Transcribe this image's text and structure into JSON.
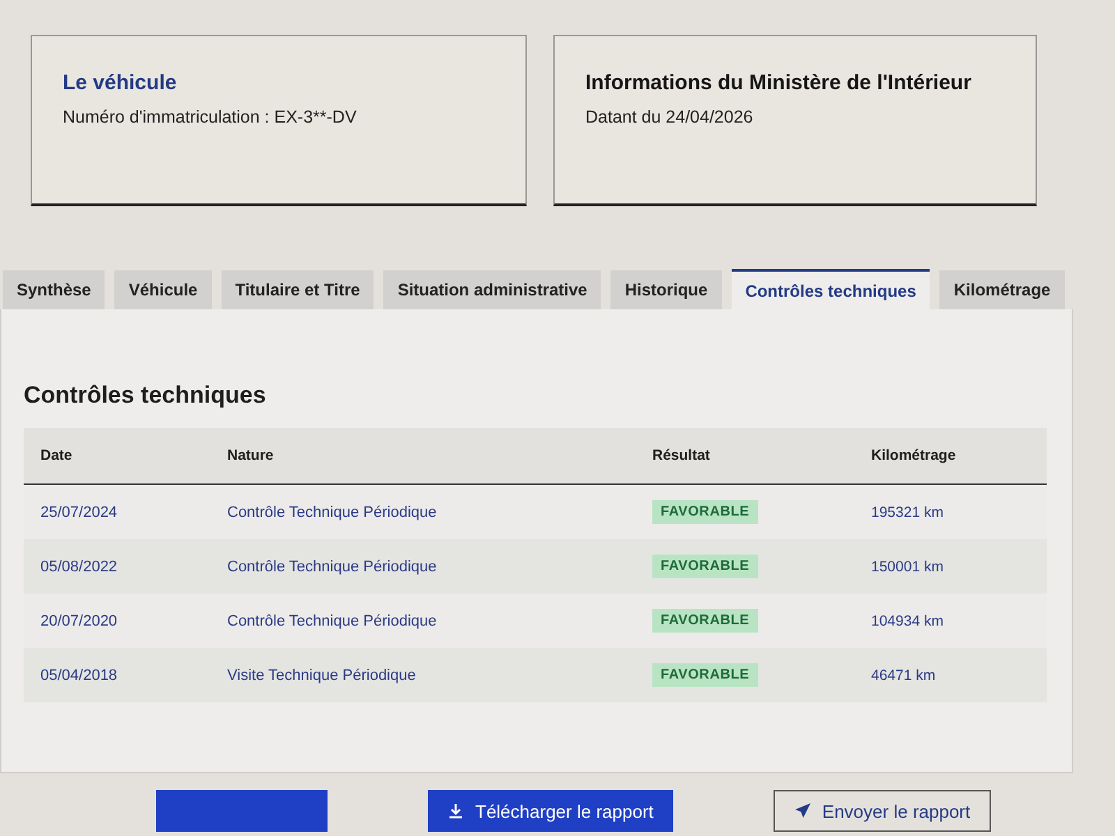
{
  "cards": [
    {
      "title": "Le véhicule",
      "text": "Numéro d'immatriculation : EX-3**-DV"
    },
    {
      "title": "Informations du Ministère de l'Intérieur",
      "text": "Datant du 24/04/2026"
    }
  ],
  "tabs": [
    {
      "label": "Synthèse",
      "selected": false
    },
    {
      "label": "Véhicule",
      "selected": false
    },
    {
      "label": "Titulaire et Titre",
      "selected": false
    },
    {
      "label": "Situation administrative",
      "selected": false
    },
    {
      "label": "Historique",
      "selected": false
    },
    {
      "label": "Contrôles techniques",
      "selected": true
    },
    {
      "label": "Kilométrage",
      "selected": false
    }
  ],
  "section": {
    "title": "Contrôles techniques",
    "columns": [
      "Date",
      "Nature",
      "Résultat",
      "Kilométrage"
    ],
    "rows": [
      {
        "date": "25/07/2024",
        "nature": "Contrôle Technique Périodique",
        "result": "FAVORABLE",
        "mileage": "195321 km"
      },
      {
        "date": "05/08/2022",
        "nature": "Contrôle Technique Périodique",
        "result": "FAVORABLE",
        "mileage": "150001 km"
      },
      {
        "date": "20/07/2020",
        "nature": "Contrôle Technique Périodique",
        "result": "FAVORABLE",
        "mileage": "104934 km"
      },
      {
        "date": "05/04/2018",
        "nature": "Visite Technique Périodique",
        "result": "FAVORABLE",
        "mileage": "46471 km"
      }
    ]
  },
  "buttons": [
    {
      "kind": "primary"
    },
    {
      "kind": "download",
      "label": "Télécharger le rapport"
    },
    {
      "kind": "send",
      "label": "Envoyer le rapport"
    }
  ]
}
